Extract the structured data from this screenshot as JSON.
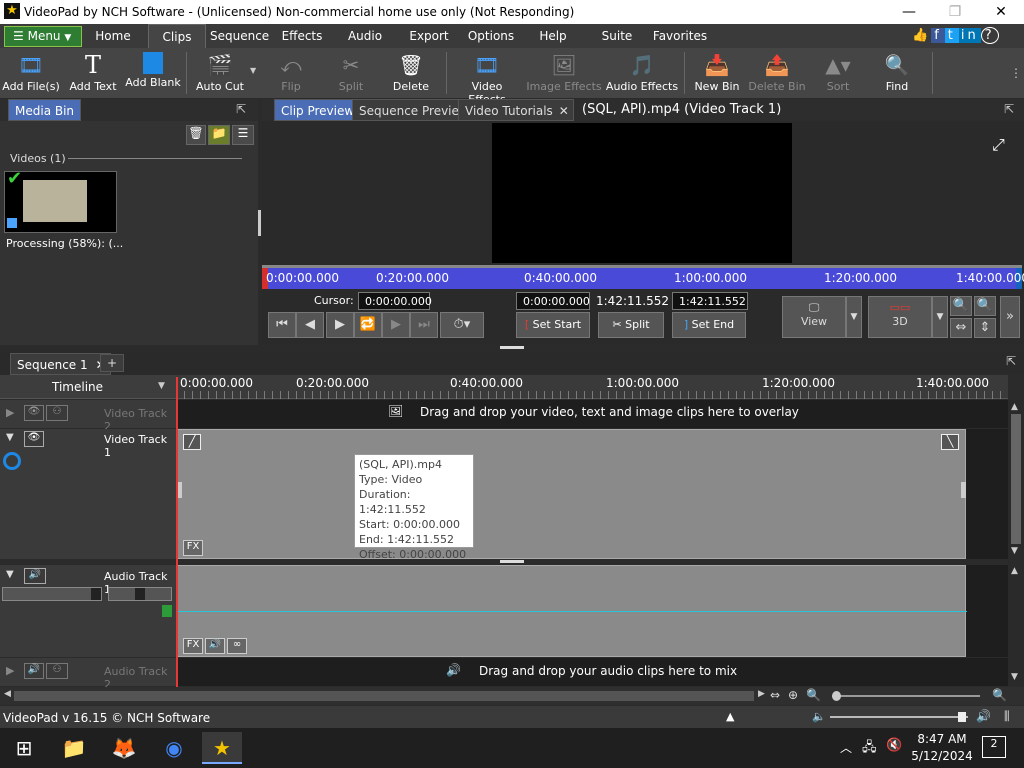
{
  "window": {
    "title": "VideoPad by NCH Software - (Unlicensed) Non-commercial home use only (Not Responding)"
  },
  "menu": {
    "menu_label": "Menu",
    "tabs": [
      "Home",
      "Clips",
      "Sequence",
      "Effects",
      "Audio",
      "Export",
      "Options",
      "Help",
      "Suite",
      "Favorites"
    ],
    "active_tab": "Clips"
  },
  "toolbar": {
    "items": [
      {
        "label": "Add File(s)",
        "enabled": true
      },
      {
        "label": "Add Text",
        "enabled": true
      },
      {
        "label": "Add Blank",
        "enabled": true
      },
      {
        "label": "Auto Cut",
        "enabled": true
      },
      {
        "label": "Flip",
        "enabled": false
      },
      {
        "label": "Split",
        "enabled": false
      },
      {
        "label": "Delete",
        "enabled": true
      },
      {
        "label": "Video Effects",
        "enabled": true
      },
      {
        "label": "Image Effects",
        "enabled": false
      },
      {
        "label": "Audio Effects",
        "enabled": true
      },
      {
        "label": "New Bin",
        "enabled": true
      },
      {
        "label": "Delete Bin",
        "enabled": false
      },
      {
        "label": "Sort",
        "enabled": false
      },
      {
        "label": "Find",
        "enabled": true
      }
    ]
  },
  "media_bin": {
    "tab": "Media Bin",
    "section": "Videos (1)",
    "clip_status": "Processing (58%): (..."
  },
  "preview": {
    "tabs": [
      "Clip Preview",
      "Sequence Preview",
      "Video Tutorials"
    ],
    "title": "(SQL, API).mp4 (Video Track 1)",
    "ruler_ticks": [
      "0:00:00.000",
      "0:20:00.000",
      "0:40:00.000",
      "1:00:00.000",
      "1:20:00.000",
      "1:40:00.000"
    ],
    "cursor_label": "Cursor:",
    "cursor_value": "0:00:00.000",
    "start_value": "0:00:00.000",
    "duration_value": "1:42:11.552",
    "end_value": "1:42:11.552",
    "set_start": "Set Start",
    "split": "Split",
    "set_end": "Set End",
    "view": "View",
    "three_d": "3D"
  },
  "sequence": {
    "tab": "Sequence 1",
    "timeline_label": "Timeline",
    "ruler_ticks": [
      "0:00:00.000",
      "0:20:00.000",
      "0:40:00.000",
      "1:00:00.000",
      "1:20:00.000",
      "1:40:00.000"
    ],
    "video_track2": "Video Track 2",
    "video_track1": "Video Track 1",
    "audio_track1": "Audio Track 1",
    "audio_track2": "Audio Track 2",
    "overlay_hint": "Drag and drop your video, text and image clips here to overlay",
    "audio_hint": "Drag and drop your audio clips here to mix",
    "fx": "FX"
  },
  "tooltip": {
    "lines": [
      "(SQL, API).mp4",
      "Type: Video",
      "Duration: 1:42:11.552",
      "Start: 0:00:00.000",
      "End: 1:42:11.552",
      "Offset: 0:00:00.000"
    ]
  },
  "status": {
    "version": "VideoPad v 16.15 © NCH Software"
  },
  "taskbar": {
    "time": "8:47 AM",
    "date": "5/12/2024",
    "notifications": "2"
  }
}
